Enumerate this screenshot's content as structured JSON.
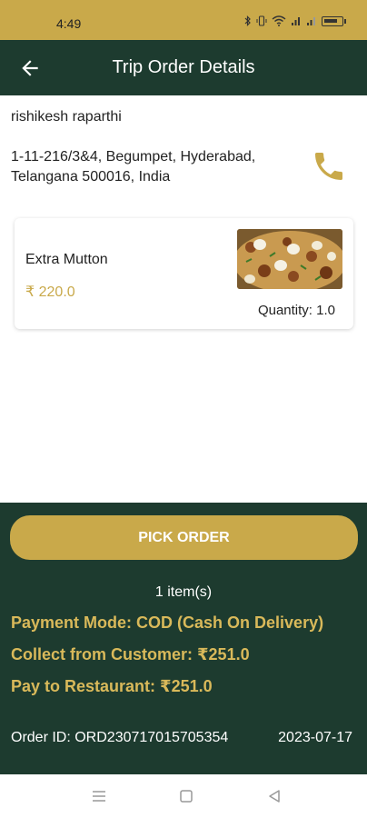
{
  "status_bar": {
    "time": "4:49",
    "icons": [
      "bluetooth-icon",
      "vibrate-icon",
      "wifi-icon",
      "signal-icon",
      "signal-icon"
    ],
    "battery_text": "80",
    "battery_level_percent": 80
  },
  "app_bar": {
    "back_icon": "arrow-left-icon",
    "title": "Trip Order Details"
  },
  "customer": {
    "name": "rishikesh raparthi",
    "address": "1-11-216/3&4, Begumpet, Hyderabad, Telangana 500016, India",
    "call_icon": "phone-icon"
  },
  "items": [
    {
      "name": "Extra Mutton",
      "price": "₹ 220.0",
      "quantity": "Quantity: 1.0",
      "image": "biryani-photo"
    }
  ],
  "actions": {
    "pick_order_label": "PICK ORDER"
  },
  "summary": {
    "item_count": "1 item(s)",
    "payment_mode": "Payment Mode: COD (Cash On Delivery)",
    "collect": "Collect from Customer: ₹251.0",
    "pay_restaurant": "Pay to Restaurant: ₹251.0",
    "order_id": "Order ID: ORD230717015705354",
    "order_date": "2023-07-17"
  },
  "nav": {
    "menu_icon": "menu-icon",
    "home_icon": "square-home-icon",
    "back_icon": "triangle-back-icon"
  },
  "colors": {
    "accent_gold": "#c9a94a",
    "dark_green": "#1d3b2f",
    "payment_text": "#d9b95a"
  }
}
